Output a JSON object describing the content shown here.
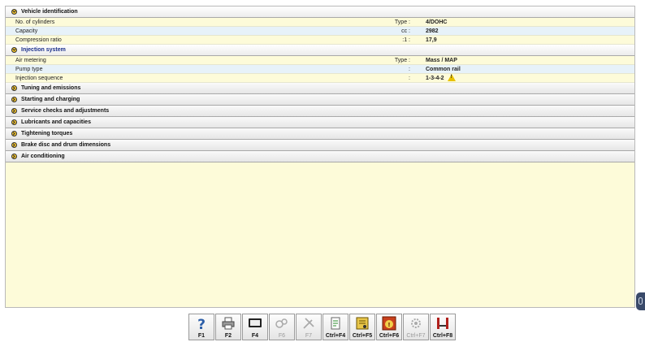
{
  "sections": [
    {
      "title": "Vehicle identification",
      "open": true,
      "active": false,
      "rows": [
        {
          "label": "No. of cylinders",
          "unit": "Type :",
          "value": "4/DOHC",
          "warning": false
        },
        {
          "label": "Capacity",
          "unit": "cc :",
          "value": "2982",
          "warning": false
        },
        {
          "label": "Compression ratio",
          "unit": ":1 :",
          "value": "17,9",
          "warning": false
        }
      ]
    },
    {
      "title": "Injection system",
      "open": true,
      "active": true,
      "rows": [
        {
          "label": "Air metering",
          "unit": "Type :",
          "value": "Mass / MAP",
          "warning": false
        },
        {
          "label": "Pump type",
          "unit": ":",
          "value": "Common rail",
          "warning": false
        },
        {
          "label": "Injection sequence",
          "unit": ":",
          "value": "1-3-4-2",
          "warning": true
        }
      ]
    },
    {
      "title": "Tuning and emissions",
      "open": false
    },
    {
      "title": "Starting and charging",
      "open": false
    },
    {
      "title": "Service checks and adjustments",
      "open": false
    },
    {
      "title": "Lubricants and capacities",
      "open": false
    },
    {
      "title": "Tightening torques",
      "open": false
    },
    {
      "title": "Brake disc and drum dimensions",
      "open": false
    },
    {
      "title": "Air conditioning",
      "open": false
    }
  ],
  "toolbar": [
    {
      "key": "F1",
      "icon": "help-icon",
      "enabled": true
    },
    {
      "key": "F2",
      "icon": "printer-icon",
      "enabled": true
    },
    {
      "key": "F4",
      "icon": "screen-icon",
      "enabled": true
    },
    {
      "key": "F6",
      "icon": "parts-icon",
      "enabled": false
    },
    {
      "key": "F7",
      "icon": "tools-icon",
      "enabled": false
    },
    {
      "key": "Ctrl+F4",
      "icon": "notes-icon",
      "enabled": true
    },
    {
      "key": "Ctrl+F5",
      "icon": "document-icon",
      "enabled": true
    },
    {
      "key": "Ctrl+F6",
      "icon": "warning-lamp-icon",
      "enabled": true
    },
    {
      "key": "Ctrl+F7",
      "icon": "gear-icon",
      "enabled": false
    },
    {
      "key": "Ctrl+F8",
      "icon": "lift-icon",
      "enabled": true
    }
  ],
  "colors": {
    "panel": "#fdfbd9",
    "alt_row": "#e7f2f9",
    "active_title": "#1a2f8a"
  }
}
